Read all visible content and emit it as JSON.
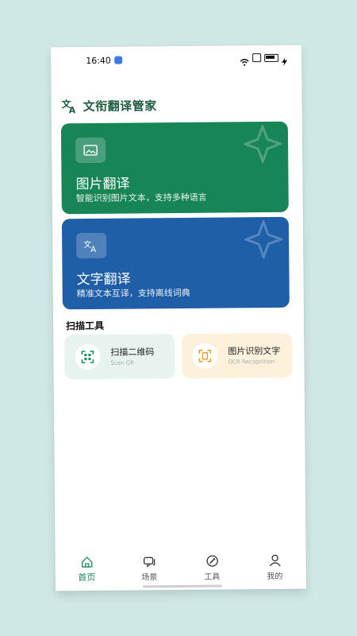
{
  "status": {
    "time": "16:40"
  },
  "app": {
    "title": "文衔翻译管家"
  },
  "cards": [
    {
      "title": "图片翻译",
      "subtitle": "智能识别图片文本，支持多种语言",
      "color": "#178556"
    },
    {
      "title": "文字翻译",
      "subtitle": "精准文本互译，支持离线词典",
      "color": "#1e5fa8"
    }
  ],
  "section": {
    "title": "扫描工具"
  },
  "tools": [
    {
      "name": "扫描二维码",
      "sub": "Scan QR",
      "icon": "qr-scan-icon",
      "bg": "#e6f3ef"
    },
    {
      "name": "图片识别文字",
      "sub": "OCR Recognition",
      "icon": "ocr-frame-icon",
      "bg": "#fdf1dc"
    }
  ],
  "tabs": [
    {
      "label": "首页",
      "icon": "home-icon",
      "active": true
    },
    {
      "label": "场景",
      "icon": "chat-icon",
      "active": false
    },
    {
      "label": "工具",
      "icon": "tool-icon",
      "active": false
    },
    {
      "label": "我的",
      "icon": "user-icon",
      "active": false
    }
  ],
  "colors": {
    "accent": "#1a8a5a",
    "brand_text": "#1f5d3f"
  }
}
